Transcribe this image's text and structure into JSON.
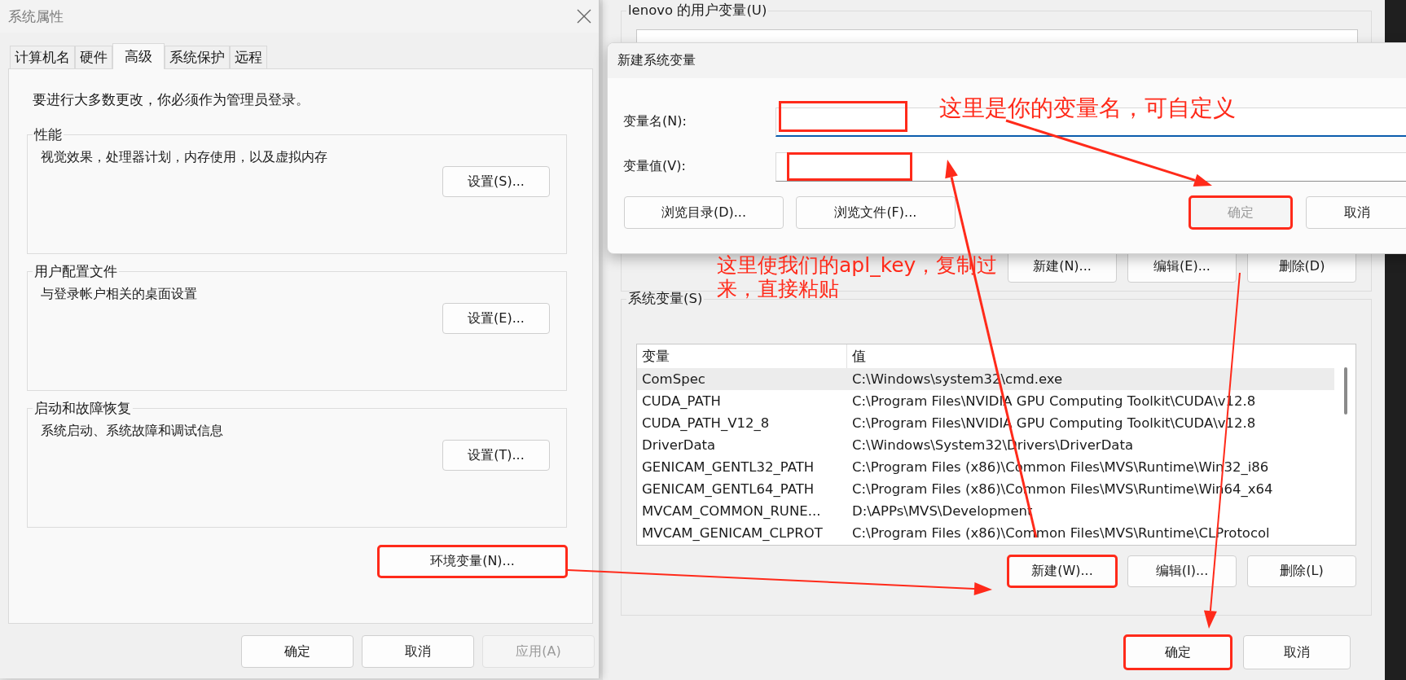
{
  "system_properties": {
    "title": "系统属性",
    "tabs": [
      {
        "label": "计算机名",
        "selected": false
      },
      {
        "label": "硬件",
        "selected": false
      },
      {
        "label": "高级",
        "selected": true
      },
      {
        "label": "系统保护",
        "selected": false
      },
      {
        "label": "远程",
        "selected": false
      }
    ],
    "notice": "要进行大多数更改，你必须作为管理员登录。",
    "groups": [
      {
        "title": "性能",
        "description": "视觉效果，处理器计划，内存使用，以及虚拟内存",
        "button": "设置(S)..."
      },
      {
        "title": "用户配置文件",
        "description": "与登录帐户相关的桌面设置",
        "button": "设置(E)..."
      },
      {
        "title": "启动和故障恢复",
        "description": "系统启动、系统故障和调试信息",
        "button": "设置(T)..."
      }
    ],
    "env_button": {
      "label": "环境变量(N)...",
      "highlighted": true
    },
    "buttons": [
      {
        "label": "确定",
        "disabled": false
      },
      {
        "label": "取消",
        "disabled": false
      },
      {
        "label": "应用(A)",
        "disabled": true
      }
    ]
  },
  "environment_variables": {
    "user_group": {
      "title": "lenovo 的用户变量(U)",
      "buttons": [
        {
          "label": "新建(N)...",
          "highlighted": false
        },
        {
          "label": "编辑(E)...",
          "highlighted": false
        },
        {
          "label": "删除(D)",
          "highlighted": false
        }
      ]
    },
    "system_group": {
      "title": "系统变量(S)",
      "columns": [
        "变量",
        "值"
      ],
      "rows": [
        {
          "name": "ComSpec",
          "value": "C:\\Windows\\system32\\cmd.exe",
          "selected": true
        },
        {
          "name": "CUDA_PATH",
          "value": "C:\\Program Files\\NVIDIA GPU Computing Toolkit\\CUDA\\v12.8",
          "selected": false
        },
        {
          "name": "CUDA_PATH_V12_8",
          "value": "C:\\Program Files\\NVIDIA GPU Computing Toolkit\\CUDA\\v12.8",
          "selected": false
        },
        {
          "name": "DriverData",
          "value": "C:\\Windows\\System32\\Drivers\\DriverData",
          "selected": false
        },
        {
          "name": "GENICAM_GENTL32_PATH",
          "value": "C:\\Program Files (x86)\\Common Files\\MVS\\Runtime\\Win32_i86",
          "selected": false
        },
        {
          "name": "GENICAM_GENTL64_PATH",
          "value": "C:\\Program Files (x86)\\Common Files\\MVS\\Runtime\\Win64_x64",
          "selected": false
        },
        {
          "name": "MVCAM_COMMON_RUNE...",
          "value": "D:\\APPs\\MVS\\Development",
          "selected": false
        },
        {
          "name": "MVCAM_GENICAM_CLPROT",
          "value": "C:\\Program Files (x86)\\Common Files\\MVS\\Runtime\\CLProtocol",
          "selected": false
        }
      ],
      "buttons": [
        {
          "label": "新建(W)...",
          "highlighted": true
        },
        {
          "label": "编辑(I)...",
          "highlighted": false
        },
        {
          "label": "删除(L)",
          "highlighted": false
        }
      ]
    },
    "buttons": [
      {
        "label": "确定",
        "highlighted": true
      },
      {
        "label": "取消",
        "highlighted": false
      }
    ]
  },
  "new_variable_dialog": {
    "title": "新建系统变量",
    "fields": [
      {
        "label": "变量名(N):",
        "focused": true,
        "highlighted": true
      },
      {
        "label": "变量值(V):",
        "focused": false,
        "highlighted": true
      }
    ],
    "left_buttons": [
      {
        "label": "浏览目录(D)...",
        "disabled": false
      },
      {
        "label": "浏览文件(F)...",
        "disabled": false
      }
    ],
    "right_buttons": [
      {
        "label": "确定",
        "disabled": true,
        "highlighted": true
      },
      {
        "label": "取消",
        "disabled": false,
        "highlighted": false
      }
    ]
  },
  "annotations": [
    {
      "text": "这里是你的变量名，可自定义"
    },
    {
      "text": "这里使我们的apl_key，复制过来，直接粘贴"
    }
  ]
}
